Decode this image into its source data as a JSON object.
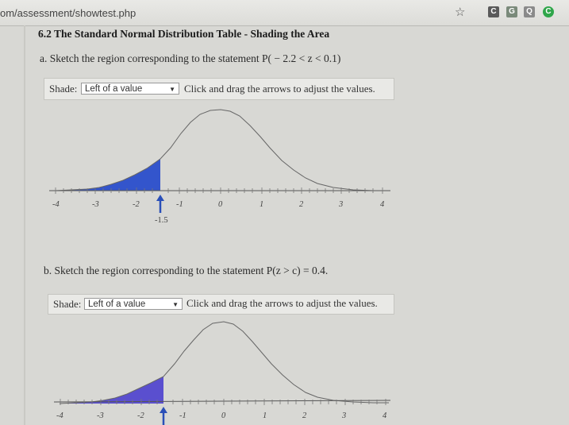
{
  "browser": {
    "url": "om/assessment/showtest.php",
    "star_icon": "star-icon",
    "extensions": [
      "C",
      "G",
      "Q",
      "C"
    ]
  },
  "section": {
    "title": "6.2 The Standard Normal Distribution Table - Shading the Area"
  },
  "part_a": {
    "statement": "a. Sketch the region corresponding to the statement P( − 2.2 < z < 0.1)",
    "shade_label": "Shade:",
    "select_value": "Left of a value",
    "instruction": "Click and drag the arrows to adjust the values.",
    "arrow_value_label": "-1.5"
  },
  "part_b": {
    "statement": "b. Sketch the region corresponding to the statement P(z > c) = 0.4.",
    "shade_label": "Shade:",
    "select_value": "Left of a value",
    "instruction": "Click and drag the arrows to adjust the values."
  },
  "axis": {
    "ticks": [
      "-4",
      "-3",
      "-2",
      "-1",
      "0",
      "1",
      "2",
      "3",
      "4"
    ]
  },
  "colors": {
    "shade_fill": "#3355cc",
    "shade_fill_b": "#5a4fcf",
    "arrow": "#2a4fb8"
  }
}
